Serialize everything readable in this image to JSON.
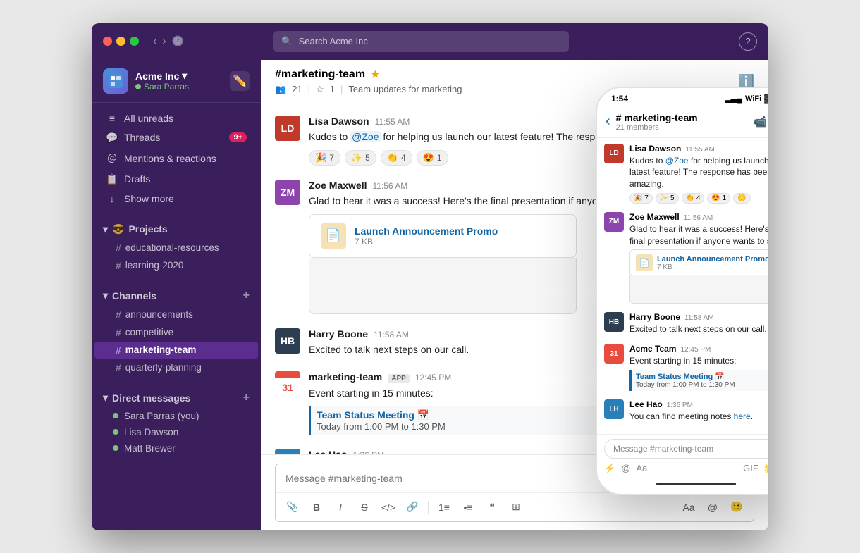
{
  "titleBar": {
    "searchPlaceholder": "Search Acme Inc"
  },
  "sidebar": {
    "workspace": {
      "name": "Acme Inc",
      "chevron": "▾",
      "user": "Sara Parras"
    },
    "nav": [
      {
        "icon": "≡",
        "label": "All unreads"
      },
      {
        "icon": "💬",
        "label": "Threads",
        "badge": "9+"
      },
      {
        "icon": "＠",
        "label": "Mentions & reactions"
      },
      {
        "icon": "📋",
        "label": "Drafts"
      },
      {
        "icon": "↓",
        "label": "Show more"
      }
    ],
    "projectsSection": {
      "emoji": "😎",
      "label": "Projects",
      "channels": [
        "educational-resources",
        "learning-2020"
      ]
    },
    "channelsSection": {
      "label": "Channels",
      "channels": [
        "announcements",
        "competitive",
        "marketing-team",
        "quarterly-planning"
      ],
      "active": "marketing-team"
    },
    "dmSection": {
      "label": "Direct messages",
      "users": [
        {
          "name": "Sara Parras",
          "suffix": "(you)",
          "online": true
        },
        {
          "name": "Lisa Dawson",
          "online": true
        },
        {
          "name": "Matt Brewer",
          "online": true
        }
      ]
    }
  },
  "chat": {
    "channel": "#marketing-team",
    "starred": true,
    "members": "21",
    "stars": "1",
    "description": "Team updates for marketing",
    "messages": [
      {
        "author": "Lisa Dawson",
        "time": "11:55 AM",
        "avatar_color": "#c0392b",
        "avatar_initials": "LD",
        "text_before": "Kudos to ",
        "mention": "@Zoe",
        "text_after": " for helping us launch our latest feature! The response has been amazing.",
        "reactions": [
          {
            "emoji": "🎉",
            "count": "7"
          },
          {
            "emoji": "✨",
            "count": "5"
          },
          {
            "emoji": "👏",
            "count": "4"
          },
          {
            "emoji": "😍",
            "count": "1"
          }
        ]
      },
      {
        "author": "Zoe Maxwell",
        "time": "11:56 AM",
        "avatar_color": "#8e44ad",
        "avatar_initials": "ZM",
        "text": "Glad to hear it was a success! Here's the final presentation if anyone wants to see:",
        "file": {
          "name": "Launch Announcement Promo",
          "size": "7 KB"
        }
      },
      {
        "author": "Harry Boone",
        "time": "11:58 AM",
        "avatar_color": "#2c3e50",
        "avatar_initials": "HB",
        "text": "Excited to talk next steps on our call."
      },
      {
        "author": "Acme Team",
        "time": "12:45 PM",
        "avatar_initials": "31",
        "app_badge": "APP",
        "text_intro": "Event starting in 15 minutes:",
        "event": {
          "title": "Team Status Meeting 📅",
          "time": "Today from 1:00 PM to 1:30 PM"
        }
      },
      {
        "author": "Lee Hao",
        "time": "1:36 PM",
        "avatar_color": "#2980b9",
        "avatar_initials": "LH",
        "text_before": "You can find meeting notes ",
        "link": "here",
        "text_after": "."
      }
    ],
    "inputPlaceholder": "Message #marketing-team"
  },
  "phone": {
    "time": "1:54",
    "channel": "# marketing-team",
    "members": "21 members",
    "inputPlaceholder": "Message #marketing-team"
  }
}
